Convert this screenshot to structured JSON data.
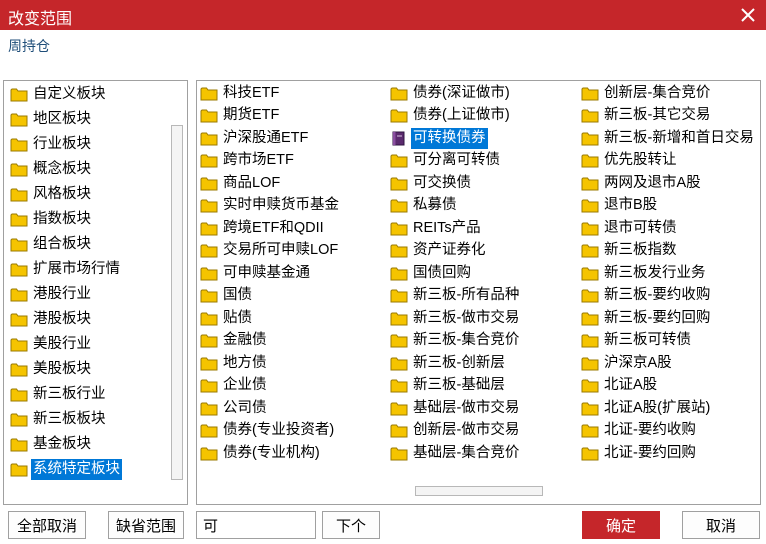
{
  "window": {
    "title": "改变范围",
    "close_icon": "close-icon"
  },
  "subtitle": "周持仓",
  "colors": {
    "accent": "#c5262a",
    "selection": "#0078d7",
    "folder": "#f5c400"
  },
  "left_list": {
    "selected": "系统特定板块",
    "items": [
      "自定义板块",
      "地区板块",
      "行业板块",
      "概念板块",
      "风格板块",
      "指数板块",
      "组合板块",
      "扩展市场行情",
      "港股行业",
      "港股板块",
      "美股行业",
      "美股板块",
      "新三板行业",
      "新三板板块",
      "基金板块",
      "系统特定板块"
    ]
  },
  "right_list": {
    "selected": "可转换债券",
    "columns": [
      [
        "科技ETF",
        "期货ETF",
        "沪深股通ETF",
        "跨市场ETF",
        "商品LOF",
        "实时申赎货币基金",
        "跨境ETF和QDII",
        "交易所可申赎LOF",
        "可申赎基金通",
        "国债",
        "贴债",
        "金融债",
        "地方债",
        "企业债",
        "公司债",
        "债券(专业投资者)",
        "债券(专业机构)"
      ],
      [
        "债券(深证做市)",
        "债券(上证做市)",
        "可转换债券",
        "可分离可转债",
        "可交换债",
        "私募债",
        "REITs产品",
        "资产证券化",
        "国债回购",
        "新三板-所有品种",
        "新三板-做市交易",
        "新三板-集合竞价",
        "新三板-创新层",
        "新三板-基础层",
        "基础层-做市交易",
        "创新层-做市交易",
        "基础层-集合竞价"
      ],
      [
        "创新层-集合竞价",
        "新三板-其它交易",
        "新三板-新增和首日交易",
        "优先股转让",
        "两网及退市A股",
        "退市B股",
        "退市可转债",
        "新三板指数",
        "新三板发行业务",
        "新三板-要约收购",
        "新三板-要约回购",
        "新三板可转债",
        "沪深京A股",
        "北证A股",
        "北证A股(扩展站)",
        "北证-要约收购",
        "北证-要约回购"
      ]
    ]
  },
  "footer": {
    "clear_all": "全部取消",
    "default_range": "缺省范围",
    "search_value": "可",
    "next": "下个",
    "confirm": "确定",
    "cancel": "取消"
  }
}
